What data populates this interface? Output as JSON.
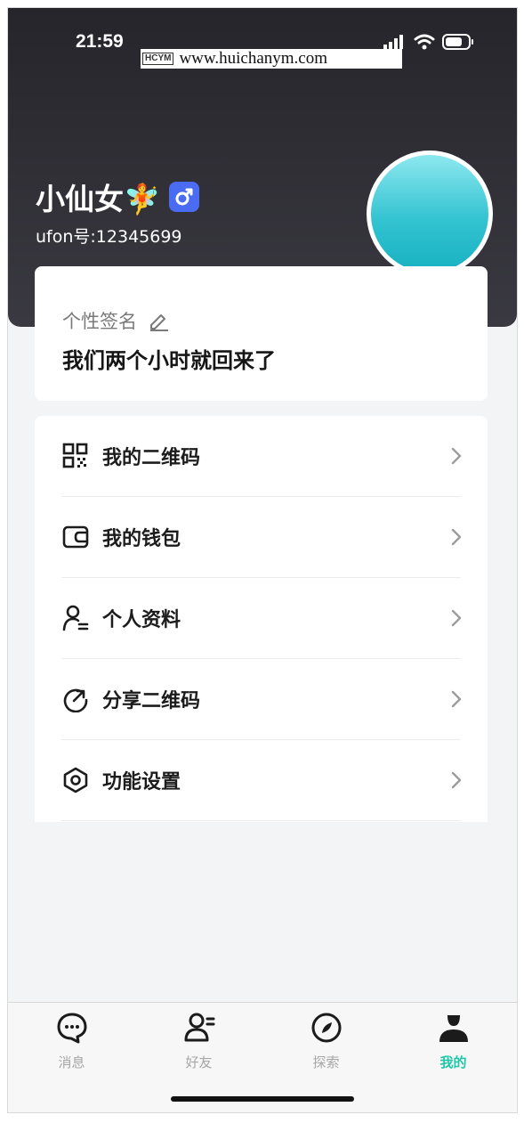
{
  "status_bar": {
    "time": "21:59",
    "icons": [
      "signal-icon",
      "wifi-icon",
      "battery-icon"
    ]
  },
  "watermark": {
    "logo": "HCYM",
    "text": "www.huichanym.com"
  },
  "profile": {
    "name": "小仙女🧚",
    "gender_icon": "male-icon",
    "user_id": "ufon号:12345699"
  },
  "signature": {
    "label": "个性签名",
    "icon": "edit-pencil-icon",
    "text": "我们两个小时就回来了"
  },
  "menu": [
    {
      "icon": "qr-code-icon",
      "label": "我的二维码"
    },
    {
      "icon": "wallet-icon",
      "label": "我的钱包"
    },
    {
      "icon": "personal-info-icon",
      "label": "个人资料"
    },
    {
      "icon": "share-icon",
      "label": "分享二维码"
    },
    {
      "icon": "settings-hexagon-icon",
      "label": "功能设置"
    }
  ],
  "tabs": [
    {
      "icon": "message-bubble-icon",
      "label": "消息",
      "active": false
    },
    {
      "icon": "friends-icon",
      "label": "好友",
      "active": false
    },
    {
      "icon": "compass-icon",
      "label": "探索",
      "active": false
    },
    {
      "icon": "user-profile-icon",
      "label": "我的",
      "active": true
    }
  ],
  "colors": {
    "header_bg": "#2d2c33",
    "accent": "#1fc6a8",
    "gender_badge": "#4a6cf3",
    "avatar": "#2fc1cf"
  }
}
